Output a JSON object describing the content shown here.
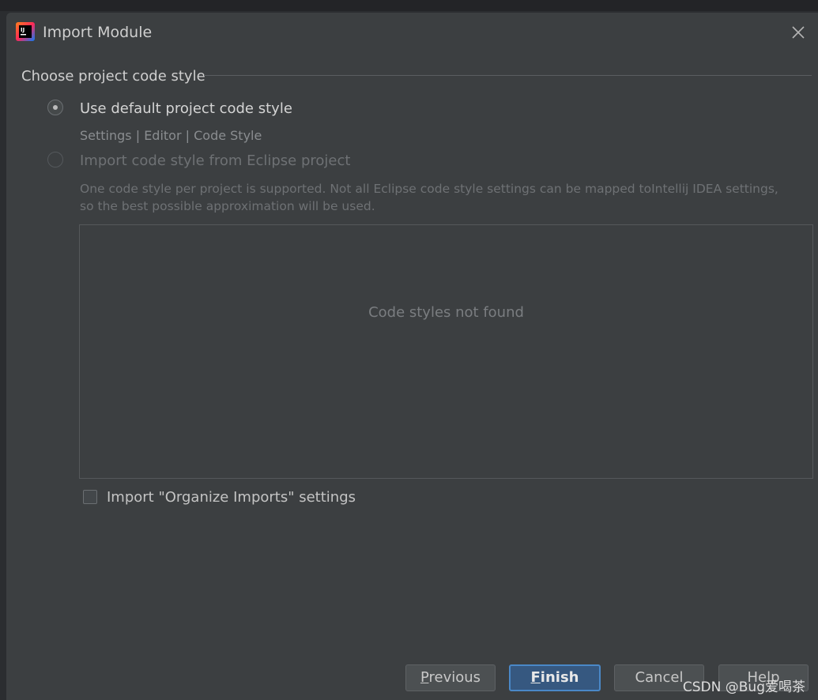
{
  "window": {
    "title": "Import Module",
    "icon": "intellij-idea-icon"
  },
  "section": {
    "title": "Choose project code style"
  },
  "options": [
    {
      "label": "Use default project code style",
      "sublabel": "Settings | Editor | Code Style",
      "selected": true
    },
    {
      "label": "Import code style from Eclipse project",
      "selected": false
    }
  ],
  "description": {
    "line1": "One code style per project is supported. Not all Eclipse code style settings can be mapped toIntellij IDEA settings,",
    "line2": "so the best possible approximation will be used."
  },
  "code_styles": {
    "empty_text": "Code styles not found"
  },
  "organize_imports": {
    "label": "Import \"Organize Imports\" settings",
    "checked": false
  },
  "buttons": {
    "previous": {
      "mnemonic": "P",
      "rest": "revious"
    },
    "finish": {
      "mnemonic": "F",
      "rest": "inish"
    },
    "cancel": {
      "label": "Cancel"
    },
    "help": {
      "label": "Help"
    }
  },
  "watermark": {
    "text": "CSDN @Bug爱喝茶"
  },
  "colors": {
    "dialog_bg": "#3c3f41",
    "finish_bg": "#365880",
    "finish_border": "#4a88c7"
  }
}
